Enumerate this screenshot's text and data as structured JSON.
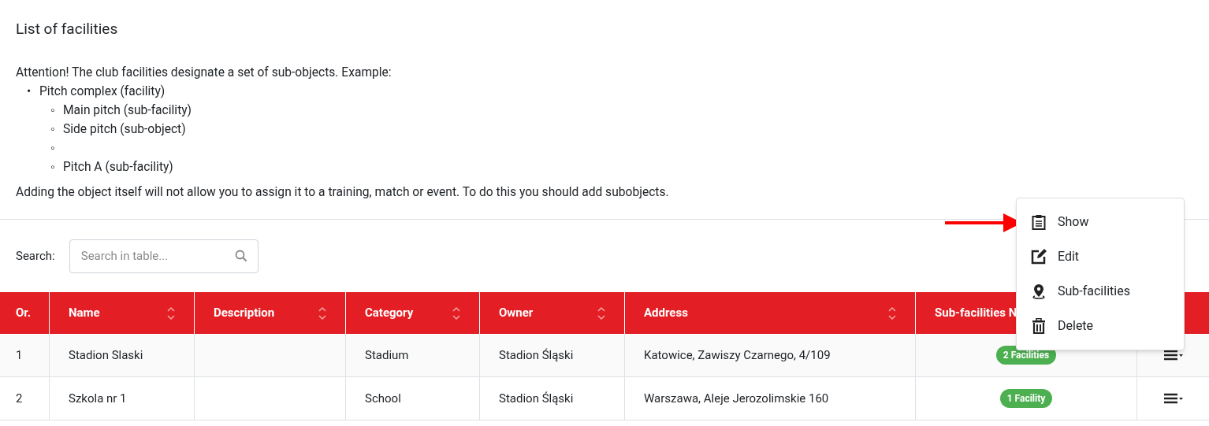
{
  "title": "List of facilities",
  "notice": {
    "intro": "Attention! The club facilities designate a set of sub-objects. Example:",
    "list": [
      {
        "marker": "•",
        "text": "Pitch complex (facility)",
        "children": [
          {
            "marker": "◦",
            "text": "Main pitch (sub-facility)"
          },
          {
            "marker": "◦",
            "text": "Side pitch (sub-object)"
          },
          {
            "marker": "◦"
          },
          {
            "marker": "◦",
            "text": "Pitch A (sub-facility)"
          }
        ]
      }
    ],
    "outro": "Adding the object itself will not allow you to assign it to a training, match or event. To do this you should add subobjects."
  },
  "search": {
    "label": "Search:",
    "placeholder": "Search in table..."
  },
  "table": {
    "columns": [
      {
        "label": "Or.",
        "sortable": false
      },
      {
        "label": "Name",
        "sortable": true
      },
      {
        "label": "Description",
        "sortable": true
      },
      {
        "label": "Category",
        "sortable": true
      },
      {
        "label": "Owner",
        "sortable": true
      },
      {
        "label": "Address",
        "sortable": true
      },
      {
        "label": "Sub-facilities N"
      }
    ],
    "rows": [
      {
        "cells": [
          "1",
          "Stadion Slaski",
          "",
          "Stadium",
          "Stadion Śląski",
          "Katowice, Zawiszy Czarnego, 4/109"
        ],
        "badge": "2 Facilities"
      },
      {
        "cells": [
          "2",
          "Szkola nr 1",
          "",
          "School",
          "Stadion Śląski",
          "Warszawa, Aleje Jerozolimskie 160"
        ],
        "badge": "1 Facility"
      }
    ]
  },
  "menu": {
    "items": [
      {
        "kind": "show",
        "label": "Show"
      },
      {
        "kind": "edit",
        "label": "Edit"
      },
      {
        "kind": "subs",
        "label": "Sub-facilities"
      },
      {
        "kind": "delete",
        "label": "Delete"
      }
    ]
  }
}
